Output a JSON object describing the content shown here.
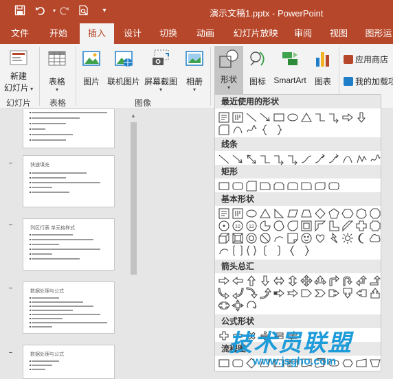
{
  "title_bar": {
    "document_title": "演示文稿1.pptx  -  PowerPoint"
  },
  "tabs": [
    "文件",
    "开始",
    "插入",
    "设计",
    "切换",
    "动画",
    "幻灯片放映",
    "审阅",
    "视图",
    "图形运"
  ],
  "active_tab": "插入",
  "ribbon": {
    "new_slide": {
      "label1": "新建",
      "label2": "幻灯片"
    },
    "table": "表格",
    "picture": "图片",
    "online_picture": "联机图片",
    "screenshot": "屏幕截图",
    "album": "相册",
    "shapes": "形状",
    "icons": "图标",
    "smartart": "SmartArt",
    "chart": "图表",
    "app_store": "应用商店",
    "my_addins": "我的加载项",
    "group_slides": "幻灯片",
    "group_table": "表格",
    "group_images": "图像",
    "brand_color": "#b7472a"
  },
  "thumbnails": [
    {
      "title": ""
    },
    {
      "title": "快速填充"
    },
    {
      "title": "列区行表  单元格样式"
    },
    {
      "title": "数据处理与公式"
    },
    {
      "title": "数据处理与公式"
    }
  ],
  "gallery": {
    "sections": {
      "recent": "最近使用的形状",
      "lines": "线条",
      "rectangles": "矩形",
      "basic": "基本形状",
      "arrows": "箭头总汇",
      "equation": "公式形状",
      "flowchart": "流程图"
    }
  },
  "watermark": {
    "text": "技术员联盟",
    "url": "www.jsgho.com"
  }
}
